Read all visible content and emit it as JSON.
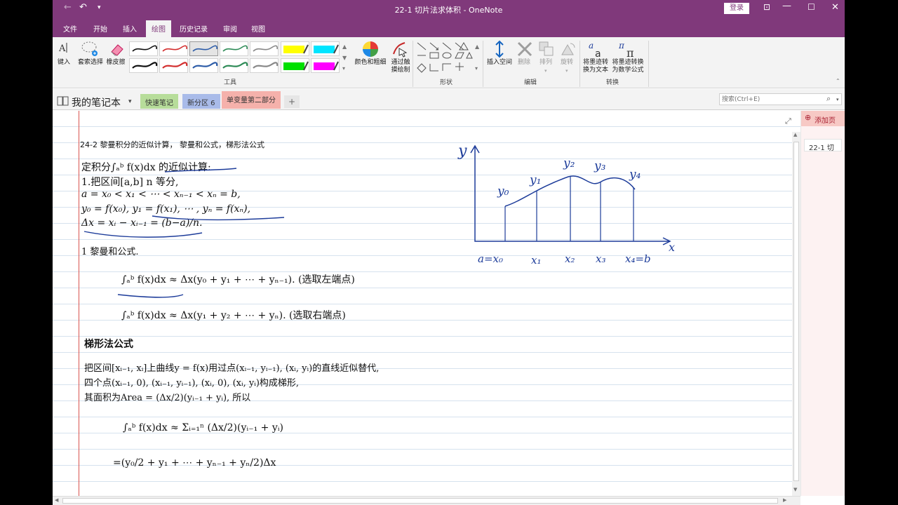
{
  "window": {
    "title": "22-1 切片法求体积  -  OneNote",
    "login": "登录"
  },
  "tabs": [
    "文件",
    "开始",
    "插入",
    "绘图",
    "历史记录",
    "审阅",
    "视图"
  ],
  "ribbon": {
    "tools": {
      "type_label": "键入",
      "lasso_label": "套索选择",
      "eraser_label": "橡皮擦",
      "color_thickness_label": "颜色和粗细",
      "touch_label1": "通过触",
      "touch_label2": "摸绘制",
      "group": "工具"
    },
    "shapes_group": "形状",
    "edit": {
      "insert_space": "插入空间",
      "delete": "删除",
      "arrange": "排列",
      "rotate": "旋转",
      "group": "编辑"
    },
    "convert": {
      "ink_to_text1": "将墨迹转",
      "ink_to_text2": "换为文本",
      "ink_to_math1": "将墨迹转换",
      "ink_to_math2": "为数学公式",
      "group": "转换"
    },
    "pen_colors": [
      "#111111",
      "#d32f2f",
      "#2e5da8",
      "#2e8b57",
      "#888888",
      "#111111",
      "#d32f2f",
      "#2e5da8",
      "#2e8b57",
      "#888888"
    ],
    "highlighters": [
      "#ffff00",
      "#00e5ff",
      "#00e000",
      "#ff00ff"
    ]
  },
  "notebook": {
    "name": "我的笔记本",
    "sections": [
      {
        "label": "快速笔记",
        "color": "#b7dd9a"
      },
      {
        "label": "新分区 6",
        "color": "#a9bbe9"
      },
      {
        "label": "单变量第二部分",
        "color": "#f5b1ab"
      }
    ],
    "add_section": "+",
    "search_placeholder": "搜索(Ctrl+E)"
  },
  "right_pane": {
    "add_page": "添加页",
    "page_item": "22-1 切"
  },
  "note": {
    "heading": "24-2 黎曼积分的近似计算，  黎曼和公式，梯形法公式",
    "l1": "定积分∫ₐᵇ f(x)dx 的近似计算:",
    "l2": "1.把区间[a,b] n 等分,",
    "l3": "a = x₀ < x₁ < ⋯ < xₙ₋₁ < xₙ = b,",
    "l4": "y₀ = f(x₀), y₁ = f(x₁), ⋯ , yₙ = f(xₙ),",
    "l5": "Δx = xᵢ − xᵢ₋₁ = (b−a)/n.",
    "riemann_title": "1  黎曼和公式.",
    "riemann_left": "∫ₐᵇ f(x)dx ≈ Δx(y₀ + y₁ + ⋯ + yₙ₋₁).  (选取左端点)",
    "riemann_right": "∫ₐᵇ f(x)dx ≈ Δx(y₁ + y₂ + ⋯ + yₙ).  (选取右端点)",
    "trap_title": "梯形法公式",
    "t1": "把区间[xᵢ₋₁, xᵢ]上曲线y = f(x)用过点(xᵢ₋₁, yᵢ₋₁), (xᵢ, yᵢ)的直线近似替代,",
    "t2": "四个点(xᵢ₋₁, 0), (xᵢ₋₁, yᵢ₋₁), (xᵢ, 0), (xᵢ, yᵢ)构成梯形,",
    "t3": "其面积为Area = (Δx/2)(yᵢ₋₁ + yᵢ), 所以",
    "f1": "∫ₐᵇ f(x)dx ≈ Σᵢ₌₁ⁿ (Δx/2)(yᵢ₋₁ + yᵢ)",
    "f2": "=(y₀/2 + y₁ + ⋯ + yₙ₋₁ + yₙ/2)Δx"
  },
  "sketch": {
    "y_axis": "y",
    "x_axis": "x",
    "y_labels": [
      "y₀",
      "y₁",
      "y₂",
      "y₃",
      "y₄"
    ],
    "x_labels": [
      "a=x₀",
      "x₁",
      "x₂",
      "x₃",
      "x₄=b"
    ],
    "ink_color": "#1d3c9a"
  }
}
